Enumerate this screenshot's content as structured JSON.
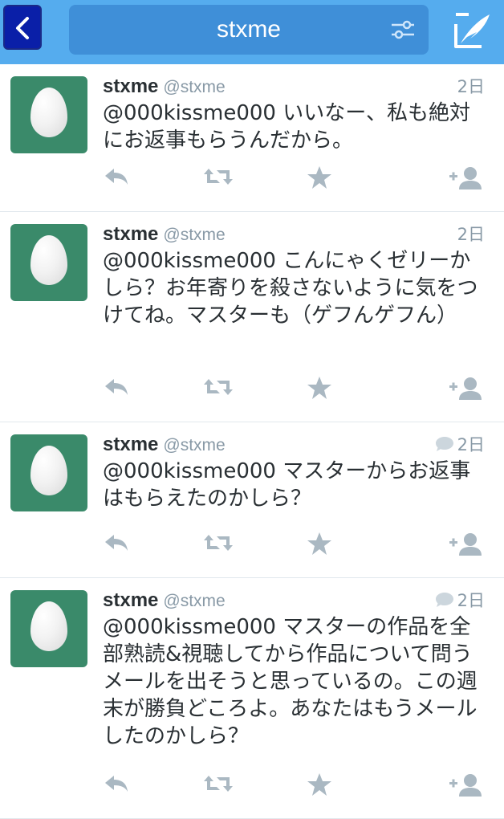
{
  "header": {
    "title": "stxme",
    "back_icon": "chevron-left-icon",
    "filter_icon": "sliders-icon",
    "compose_icon": "compose-quill-icon",
    "colors": {
      "bar": "#55acee",
      "title_box": "#3f8fd8",
      "back": "#0a1fa8"
    }
  },
  "tweets": [
    {
      "name": "stxme",
      "handle": "@stxme",
      "time": "2日",
      "has_reply_icon": false,
      "text": "@000kissme000 いいなー、私も絶対にお返事もらうんだから。"
    },
    {
      "name": "stxme",
      "handle": "@stxme",
      "time": "2日",
      "has_reply_icon": false,
      "text": "@000kissme000 こんにゃくゼリーかしら？お年寄りを殺さないように気をつけてね。マスターも（ゲフんゲフん）"
    },
    {
      "name": "stxme",
      "handle": "@stxme",
      "time": "2日",
      "has_reply_icon": true,
      "text": "@000kissme000 マスターからお返事はもらえたのかしら？"
    },
    {
      "name": "stxme",
      "handle": "@stxme",
      "time": "2日",
      "has_reply_icon": true,
      "text": "@000kissme000 マスターの作品を全部熟読&視聴してから作品について問うメールを出そうと思っているの。この週末が勝負どころよ。あなたはもうメールしたのかしら？"
    }
  ],
  "action_icons": [
    "reply-icon",
    "retweet-icon",
    "favorite-star-icon",
    "follow-add-icon"
  ]
}
